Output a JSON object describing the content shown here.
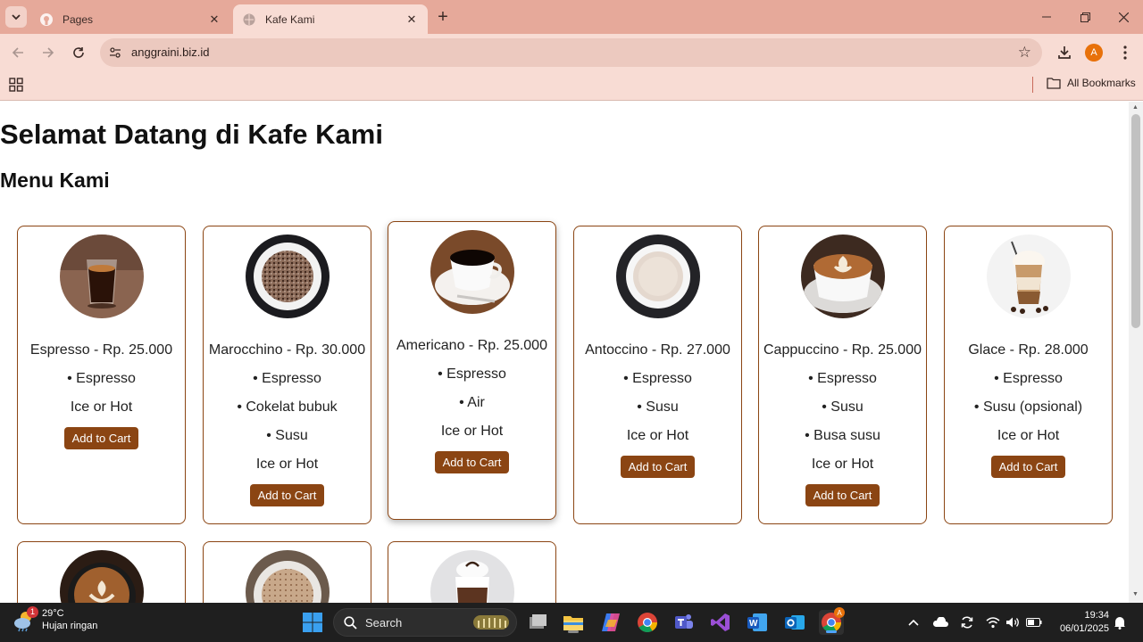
{
  "browser": {
    "tabs": [
      {
        "title": "Pages",
        "favicon": "github-icon"
      },
      {
        "title": "Kafe Kami",
        "favicon": "globe-icon"
      }
    ],
    "url": "anggraini.biz.id",
    "bookmarks_label": "All Bookmarks",
    "profile_initial": "A"
  },
  "page": {
    "title": "Selamat Datang di Kafe Kami",
    "section": "Menu Kami",
    "button_label": "Add to Cart",
    "menu": [
      {
        "name": "Espresso - Rp. 25.000",
        "items": [
          "• Espresso",
          "Ice or Hot"
        ],
        "image": "espresso-shot"
      },
      {
        "name": "Marocchino - Rp. 30.000",
        "items": [
          "• Espresso",
          "• Cokelat bubuk",
          "• Susu",
          "Ice or Hot"
        ],
        "image": "marocchino"
      },
      {
        "name": "Americano - Rp. 25.000",
        "items": [
          "• Espresso",
          "• Air",
          "Ice or Hot"
        ],
        "image": "americano"
      },
      {
        "name": "Antoccino - Rp. 27.000",
        "items": [
          "• Espresso",
          "• Susu",
          "Ice or Hot"
        ],
        "image": "antoccino"
      },
      {
        "name": "Cappuccino - Rp. 25.000",
        "items": [
          "• Espresso",
          "• Susu",
          "• Busa susu",
          "Ice or Hot"
        ],
        "image": "cappuccino"
      },
      {
        "name": "Glace - Rp. 28.000",
        "items": [
          "• Espresso",
          "• Susu (opsional)",
          "Ice or Hot"
        ],
        "image": "glace"
      }
    ]
  },
  "taskbar": {
    "weather_badge": "1",
    "temperature": "29°C",
    "condition": "Hujan ringan",
    "search_label": "Search",
    "time": "19:34",
    "date": "06/01/2025",
    "chrome_badge": "A"
  }
}
